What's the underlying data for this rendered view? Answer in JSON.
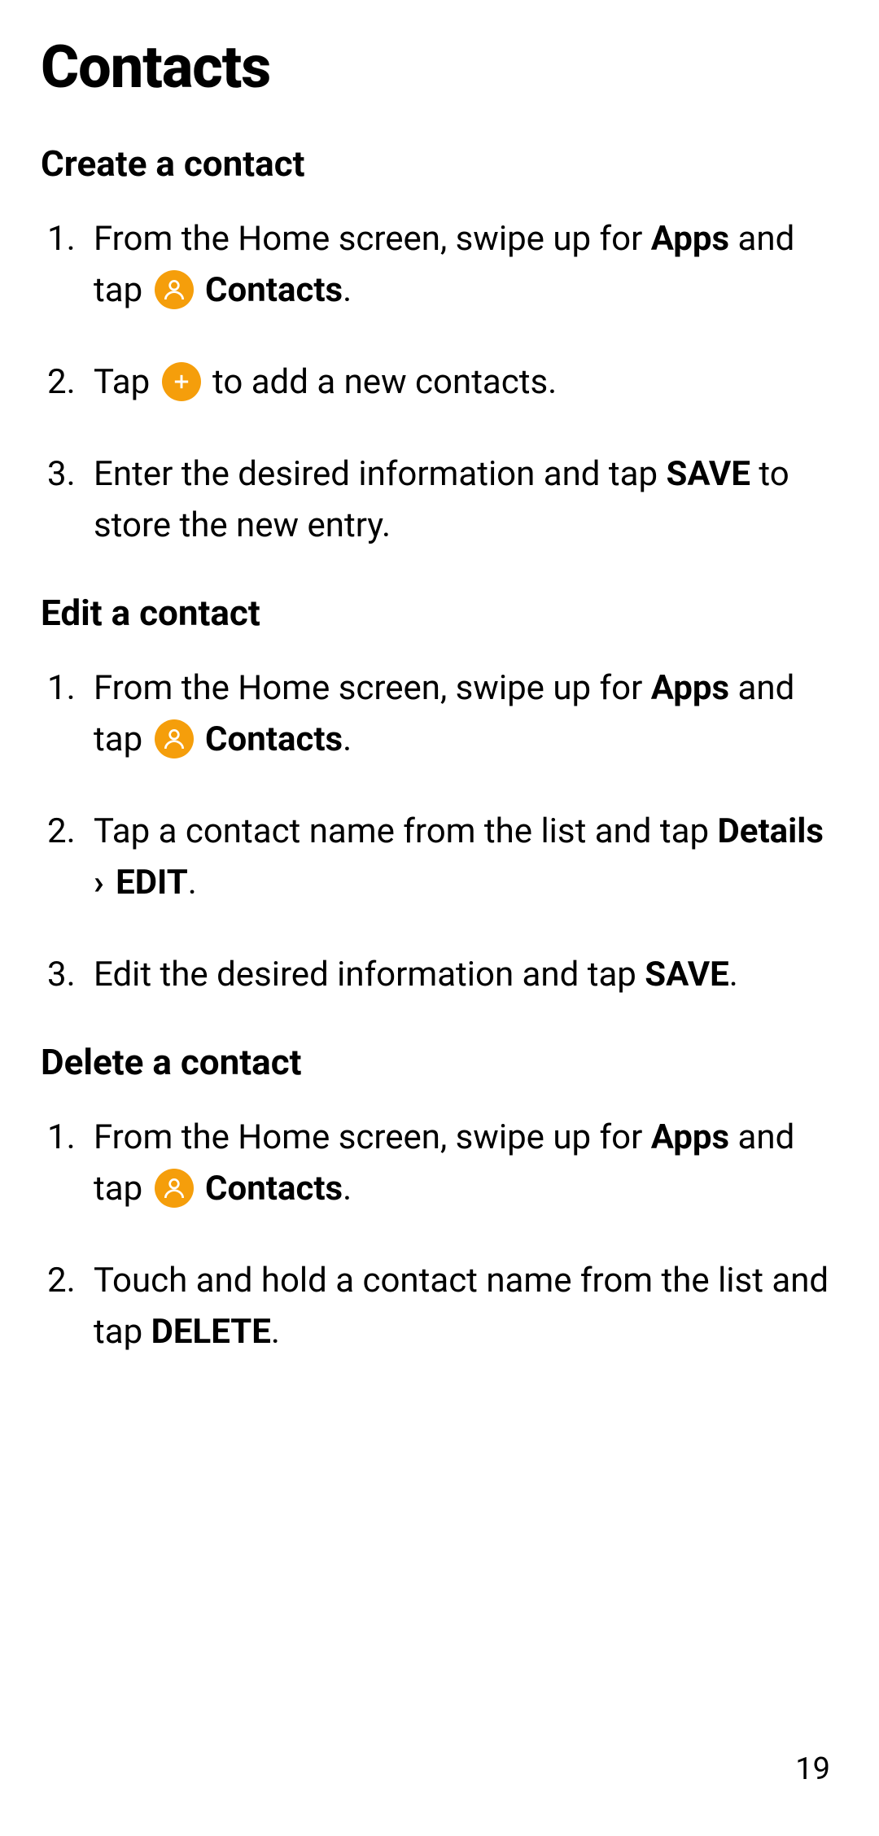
{
  "pageTitle": "Contacts",
  "pageNumber": "19",
  "sections": {
    "create": {
      "heading": "Create a contact",
      "step1_part1": "From the Home screen, swipe up for ",
      "step1_apps": "Apps",
      "step1_part2": " and tap ",
      "step1_contacts": " Contacts",
      "step1_end": ".",
      "step2_part1": "Tap ",
      "step2_part2": " to add a new contacts.",
      "step3_part1": "Enter the desired information and tap ",
      "step3_save": "SAVE",
      "step3_part2": " to store the new entry."
    },
    "edit": {
      "heading": "Edit a contact",
      "step1_part1": "From the Home screen, swipe up for ",
      "step1_apps": "Apps",
      "step1_part2": " and tap ",
      "step1_contacts": " Contacts",
      "step1_end": ".",
      "step2_part1": "Tap a contact name from the list and tap ",
      "step2_details": "Details",
      "step2_chevron": " › ",
      "step2_edit": "EDIT",
      "step2_end": ".",
      "step3_part1": "Edit the desired information and tap ",
      "step3_save": "SAVE",
      "step3_end": "."
    },
    "delete": {
      "heading": "Delete a contact",
      "step1_part1": "From the Home screen, swipe up for ",
      "step1_apps": "Apps",
      "step1_part2": " and tap ",
      "step1_contacts": " Contacts",
      "step1_end": ".",
      "step2_part1": "Touch and hold a contact name from the list and tap ",
      "step2_delete": "DELETE",
      "step2_end": "."
    }
  }
}
